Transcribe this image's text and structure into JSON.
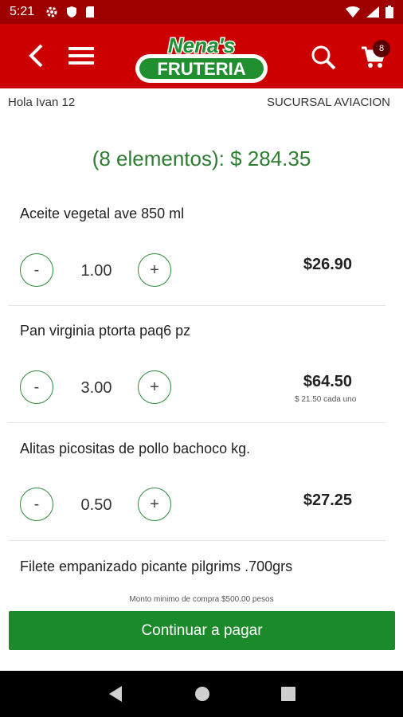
{
  "status_bar": {
    "time": "5:21"
  },
  "header": {
    "logo_top": "Nena's",
    "logo_bottom": "FRUTERIA",
    "cart_count": "8"
  },
  "info": {
    "greeting": "Hola Ivan 12",
    "branch": "SUCURSAL AVIACION"
  },
  "cart": {
    "summary": "(8 elementos): $ 284.35"
  },
  "items": [
    {
      "name": "Aceite vegetal ave 850 ml",
      "minus": "-",
      "plus": "+",
      "qty": "1.00",
      "price": "$26.90",
      "unit_price": ""
    },
    {
      "name": "Pan virginia ptorta paq6 pz",
      "minus": "-",
      "plus": "+",
      "qty": "3.00",
      "price": "$64.50",
      "unit_price": "$ 21.50 cada uno"
    },
    {
      "name": "Alitas picositas de pollo bachoco kg.",
      "minus": "-",
      "plus": "+",
      "qty": "0.50",
      "price": "$27.25",
      "unit_price": ""
    },
    {
      "name": "Filete empanizado picante pilgrims .700grs"
    }
  ],
  "footer": {
    "min_note": "Monto minimo de compra $500.00 pesos",
    "pay_button": "Continuar a pagar"
  },
  "colors": {
    "brand_red": "#cc0000",
    "green": "#2e7d32",
    "button_green": "#1b8a2b"
  }
}
